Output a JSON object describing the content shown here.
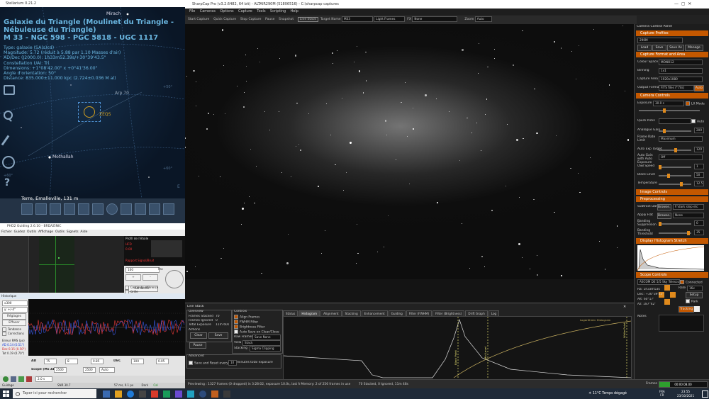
{
  "stellarium": {
    "window_title": "Stellarium 0.21.2",
    "object_title": "Galaxie du Triangle (Moulinet du Triangle - Nébuleuse du Triangle)",
    "catalog_line": "M 33 - NGC 598 - PGC 5818 - UGC 1117",
    "info_lines": [
      "Type: galaxie (SA(s)cd)",
      "Magnitude: 5.72 (réduit à 5.88 par 1.10 Masses d'air)",
      "AD/Dec (J2000.0): 1h33m52.39s/+30°39'43.5\"",
      "Constellation UAI: Tri",
      "Dimensions: +1°08'42.00\" x +0°41'36.00\"",
      "Angle d'orientation: 50°",
      "Distance: 835.000±11.000 kpc (2.724±0.036 M al)"
    ],
    "labels": {
      "mirach": "Mirach",
      "arp": "Arp 70",
      "zeqs": "ZEQS",
      "mothallah": "Mothallah",
      "plus60a": "+60°",
      "plus60b": "+60°",
      "plus50": "+50°",
      "e": "E"
    },
    "location": "Terre, Emalleville, 131 m"
  },
  "phd": {
    "window_title": "PHD2 Guiding 2.6.10 - BRDAZINIC",
    "menu": [
      "Fichier",
      "Guidez",
      "Outils",
      "Affichage",
      "Outils",
      "Signets",
      "Aide"
    ],
    "star_profile": "Profil de l'étoile",
    "hfd_label": "HFD",
    "hfd_value": "0.00",
    "snr_label": "Rapport Signal/Bruit",
    "step_value": "100",
    "step_label": "Pas",
    "refresh_label": "Rafraîchir",
    "options": [
      "Cercle de référence",
      "Grille"
    ],
    "history_title": "Historique",
    "history_dropdowns": [
      "x300",
      "y: +/-4\""
    ],
    "history_buttons": [
      "Réglages",
      "Effacer"
    ],
    "legend": [
      "Tendance",
      "Corrections"
    ],
    "stats_title": "Erreur RMS (px)",
    "stats": [
      "AD 0.14 (0.51\")",
      "Dec 0.15 (0.50\")",
      "Tot 0.19 (0.70\")",
      "RA Osc: 0.40"
    ],
    "bottom": {
      "ad_label": "AD",
      "ad_agr": "75",
      "ad_hyst": "8",
      "ad_minmo": "0.85",
      "dec_label": "DEC",
      "dec_agr": "100",
      "dec_minmo": "0.05",
      "scope_label": "Scope (Mx AD)",
      "scope_ad": "2500",
      "scope_dec": "2500",
      "mode": "Auto"
    },
    "exposure": "2.0 s",
    "status": {
      "left": "Guidage",
      "mid": "SNR 30.7",
      "val": "57 ms, 0.1 px",
      "dark": "Dark",
      "cal": "Cal"
    }
  },
  "sharpcap": {
    "window_title": "SharpCap Pro (v3.2.6482, 64 bit) - ALTAIR290M (51806516) - C:\\sharpcap captures",
    "menu": [
      "File",
      "Cameras",
      "Options",
      "Capture",
      "Tools",
      "Scripting",
      "Help"
    ],
    "toolbar": {
      "start": "Start Capture",
      "quick": "Quick Capture",
      "stop": "Stop Capture",
      "pause": "Pause",
      "snapshot": "Snapshot",
      "live_stack": "Live Stack",
      "target_label": "Target Name",
      "target_value": "M33",
      "frames": "Light Frames",
      "fx_label": "FX",
      "fx_value": "None",
      "zoom_label": "Zoom",
      "zoom_value": "Auto"
    },
    "panel": {
      "title": "Camera Control Panel",
      "capture_profiles": "Capture Profiles",
      "profile_value": "290M",
      "profile_buttons": [
        "Load",
        "Save",
        "Save As",
        "Manage"
      ],
      "format_header": "Capture Format and Area",
      "colour_space_label": "Colour Space",
      "colour_space": "MONO12",
      "binning_label": "Binning",
      "binning": "1x1",
      "area_label": "Capture Area",
      "area": "1920x1080",
      "output_label": "Output Format",
      "output": "FITS files (*.fits)",
      "auto_btn": "Auto",
      "camera_controls": "Camera Controls",
      "exposure_label": "Exposure",
      "exposure": "30.0 s",
      "lx_mode": "LX Mode",
      "quick_picks": "Quick Picks",
      "auto": "Auto",
      "gain_label": "Analogue Gain",
      "gain": "200",
      "frame_rate_label": "Frame Rate Limit",
      "frame_rate": "Maximum",
      "auto_exp_label": "Auto Exp Target",
      "auto_exp": "120",
      "auto_gain_label": "Auto Gain with Auto Exposure",
      "auto_gain": "Off",
      "usb_label": "USB Speed",
      "usb": "1",
      "black_label": "Black Level",
      "black": "50",
      "temp_label": "Temperature",
      "temp": "12.5",
      "image_controls": "Image Controls",
      "preprocessing": "Preprocessing",
      "subtract_label": "Subtract Dark",
      "subtract_btn": "Browse...",
      "subtract_value": "F:\\dark step etc",
      "flat_label": "Apply Flat",
      "flat_btn": "Browse...",
      "flat_value": "None",
      "band_label": "Banding Suppression",
      "band": "0",
      "band_thr_label": "Banding Threshold",
      "band_thr": "35",
      "histogram": "Display Histogram Stretch",
      "scope_controls": "Scope Controls",
      "scope_name": "ASCOM DE 5/5 Sky Telescope",
      "connected": "Connected",
      "rate_label": "Rate",
      "rate": "16x",
      "setup": "Setup",
      "park": "Park",
      "scope_coords": [
        "Ra: 1h33m53s",
        "Dec: +30°39'43\"",
        "Alt: 60°17'",
        "Az: 187°42'"
      ],
      "tracking": "Tracking",
      "notes": "Notes"
    },
    "live_stack": {
      "title": "Live Stack",
      "overview": "Overview",
      "frames_stacked_label": "Frames Stacked",
      "frames_stacked": "70",
      "frames_ignored_label": "Frames Ignored",
      "frames_ignored": "0",
      "total_exposure_label": "Total Exposure",
      "total_exposure": "11m 60s",
      "actions": "Actions",
      "clear": "Clear",
      "save": "Save",
      "pause": "Pause",
      "advanced": "Advanced",
      "save_reset": "Save and Reset every",
      "minutes": "minutes total exposure",
      "minutes_value": "10",
      "controls": "Controls",
      "align": "Align Frames",
      "fwhm": "FWHM Filter",
      "bright": "Brightness Filter",
      "autosave": "Auto Save on Clear/Close",
      "raw_label": "Raw Frames",
      "raw_value": "Save None",
      "view_label": "View",
      "view_value": "Stack",
      "stacking_label": "Stacking",
      "stacking_value": "Sigma Clipping",
      "tabs": [
        "Status",
        "Histogram",
        "Alignment",
        "Stacking",
        "Enhancement",
        "Guiding",
        "Filter (FWHM)",
        "Filter (Brightness)",
        "Drift Graph",
        "Log"
      ],
      "hist_legend": "Logarithmic Histogram",
      "black_point": "Black Point",
      "mid_level": "Mid Level",
      "white_point": "White Point"
    },
    "status_bar": {
      "preview": "Previewing : 1327 frames (0 dropped) in 3:28:02, exposure 10.0s, last frame 10.1 ...",
      "memory": "Memory: 2 of 256 frames in use",
      "stack": "70 Stacked, 0 Ignored, 11m 48s",
      "frames_label": "Frames",
      "progress_text": "00:00:08.00",
      "progress": 0.22
    }
  },
  "taskbar": {
    "search_placeholder": "Taper ici pour rechercher",
    "weather": "11°C Temps dégagé",
    "lang": "FRA",
    "lang2": "FR",
    "time": "23:55",
    "date": "23/10/2021"
  }
}
